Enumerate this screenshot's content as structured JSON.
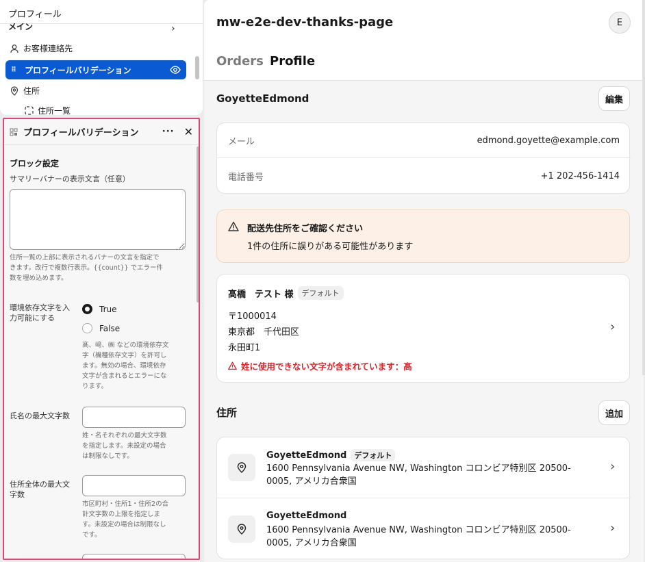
{
  "left_top": {
    "title": "プロフィール",
    "nav_main": "メイン",
    "items": [
      {
        "label": "お客様連絡先",
        "icon": "person-icon"
      },
      {
        "label": "プロフィールバリデーション",
        "icon": "eye-icon"
      },
      {
        "label": "住所",
        "icon": "location-pin-icon"
      },
      {
        "label": "住所一覧",
        "icon": "dashed-box-icon"
      }
    ]
  },
  "panel": {
    "title": "プロフィールバリデーション",
    "section": "ブロック設定",
    "banner_label": "サマリーバナーの表示文言（任意）",
    "banner_help": [
      "住所一覧の上部に表示されるバナーの文言を指定で",
      "きます。改行で複数行表示。{{count}} でエラー件",
      "数を埋め込めます。"
    ],
    "env_label": [
      "環境依存文字を入",
      "力可能にする"
    ],
    "env_options": [
      "True",
      "False"
    ],
    "env_selected": "True",
    "env_help": [
      "髙、﨑、㈱ などの環境依存文",
      "字（機種依存文字）を許可し",
      "ます。無効の場合、環境依存",
      "文字が含まれるとエラーにな",
      "ります。"
    ],
    "name_max_label": "氏名の最大文字数",
    "name_max_value": "",
    "name_max_help": [
      "姓・名それぞれの最大文字数",
      "を指定します。未設定の場合",
      "は制限なしです。"
    ],
    "addr_max_label": [
      "住所全体の最大文",
      "字数"
    ],
    "addr_max_value": "",
    "addr_max_help": [
      "市区町村・住所1・住所2の合",
      "計文字数の上限を指定しま",
      "す。未設定の場合は制限なし",
      "です。"
    ]
  },
  "right": {
    "title": "mw-e2e-dev-thanks-page",
    "avatar": "E",
    "tabs": [
      "Orders",
      "Profile"
    ],
    "active_tab": "Profile",
    "customer_name": "GoyetteEdmond",
    "edit_button": "編集",
    "email_label": "メール",
    "email_value": "edmond.goyette@example.com",
    "phone_label": "電話番号",
    "phone_value": "+1 202-456-1414",
    "warning_title": "配送先住所をご確認ください",
    "warning_body": "1件の住所に誤りがある可能性があります",
    "address_card": {
      "name": "髙橋　テスト 様",
      "badge": "デフォルト",
      "postal": "〒1000014",
      "line1": "東京都　千代田区",
      "line2": "永田町1",
      "error": "姓に使用できない文字が含まれています：髙"
    },
    "addresses_title": "住所",
    "add_button": "追加",
    "addresses": [
      {
        "name": "GoyetteEdmond",
        "badge": "デフォルト",
        "address": "1600 Pennsylvania Avenue NW, Washington コロンビア特別区 20500-0005, アメリカ合衆国"
      },
      {
        "name": "GoyetteEdmond",
        "badge": "",
        "address": "1600 Pennsylvania Avenue NW, Washington コロンビア特別区 20500-0005, アメリカ合衆国"
      }
    ]
  }
}
